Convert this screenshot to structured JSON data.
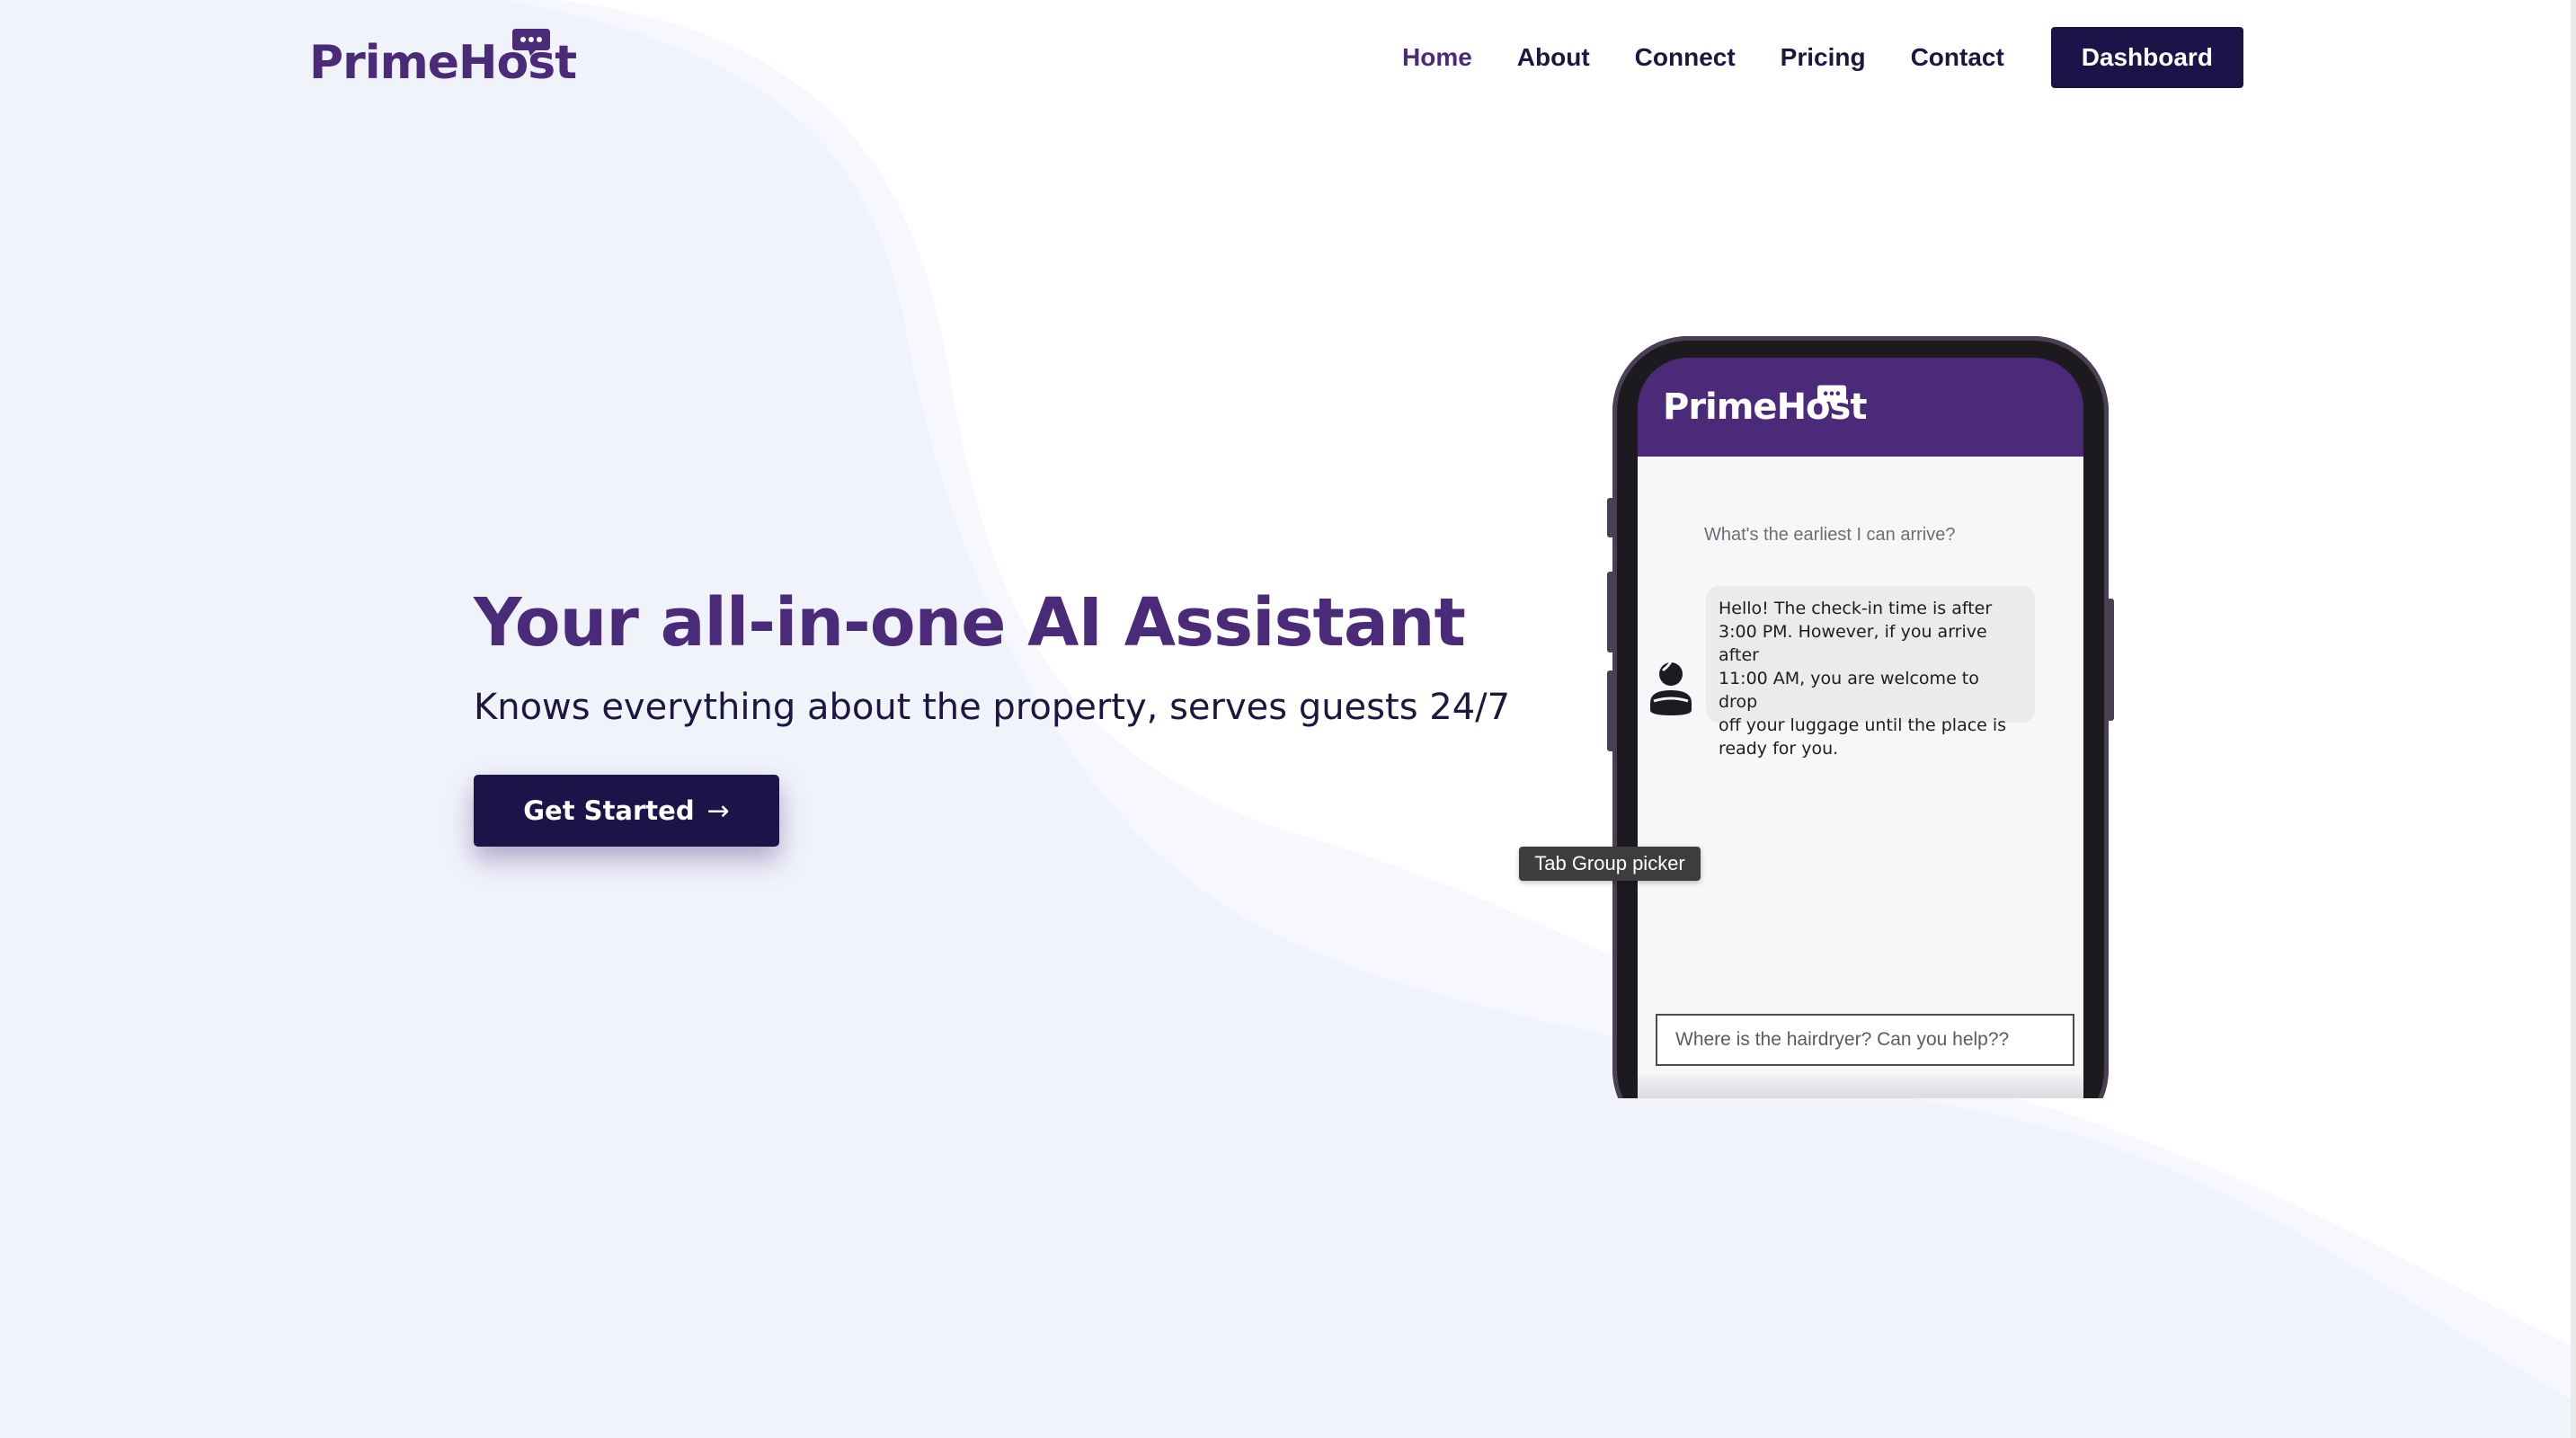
{
  "brand": {
    "name": "PrimeHost",
    "color": "#4b2a79",
    "dark": "#1e1348"
  },
  "nav": {
    "items": [
      {
        "label": "Home",
        "active": true
      },
      {
        "label": "About"
      },
      {
        "label": "Connect"
      },
      {
        "label": "Pricing"
      },
      {
        "label": "Contact"
      }
    ],
    "dashboard_label": "Dashboard"
  },
  "hero": {
    "title": "Your all-in-one AI Assistant",
    "subtitle": "Knows everything about the property, serves guests 24/7",
    "cta_label": "Get Started",
    "cta_icon": "arrow-right-icon"
  },
  "phone": {
    "app_name": "PrimeHost",
    "question": "What's the earliest I can arrive?",
    "reply_lines": [
      "Hello! The check-in time is after",
      "3:00 PM. However, if you arrive after",
      "11:00 AM, you are welcome to drop",
      "off your luggage until the place is",
      "ready for you."
    ],
    "input_placeholder": "Where is the hairdryer? Can you help??",
    "avatar_icon": "bot-avatar-icon"
  },
  "tooltip": {
    "text": "Tab Group picker"
  }
}
